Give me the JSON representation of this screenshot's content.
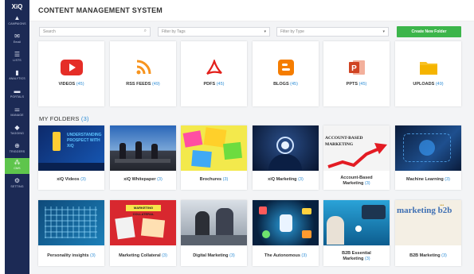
{
  "app": {
    "logo": "XiQ",
    "title": "CONTENT MANAGEMENT SYSTEM"
  },
  "sidebar": {
    "items": [
      {
        "label": "CAMPAIGNS",
        "icon": "megaphone-icon",
        "glyph": "▲"
      },
      {
        "label": "Email",
        "icon": "envelope-icon",
        "glyph": "✉"
      },
      {
        "label": "LISTS",
        "icon": "list-icon",
        "glyph": "☰"
      },
      {
        "label": "ANALYTICS",
        "icon": "bar-chart-icon",
        "glyph": "▮"
      },
      {
        "label": "PORTALS",
        "icon": "portal-icon",
        "glyph": "▬"
      },
      {
        "label": "MANAGE",
        "icon": "sliders-icon",
        "glyph": "⚌"
      },
      {
        "label": "TAGGING",
        "icon": "tag-icon",
        "glyph": "◆"
      },
      {
        "label": "TRIGGERS",
        "icon": "trigger-icon",
        "glyph": "⊕"
      },
      {
        "label": "CMS",
        "icon": "sitemap-icon",
        "glyph": "⁂",
        "active": true
      },
      {
        "label": "SETTING",
        "icon": "gear-icon",
        "glyph": "⚙"
      }
    ]
  },
  "filters": {
    "search_placeholder": "Search",
    "tags_placeholder": "Filter by Tags",
    "type_placeholder": "Filter by Type",
    "create_label": "Create New Folder"
  },
  "types": [
    {
      "name": "VIDEOS",
      "count": "(45)",
      "icon": "youtube-icon",
      "color": "#e52d27"
    },
    {
      "name": "RSS FEEDS",
      "count": "(49)",
      "icon": "rss-icon",
      "color": "#f7941e"
    },
    {
      "name": "PDFS",
      "count": "(45)",
      "icon": "pdf-icon",
      "color": "#e3201b"
    },
    {
      "name": "BLOGS",
      "count": "(45)",
      "icon": "blogger-icon",
      "color": "#f57d00"
    },
    {
      "name": "PPTS",
      "count": "(45)",
      "icon": "powerpoint-icon",
      "color": "#d04423"
    },
    {
      "name": "UPLOADS",
      "count": "(49)",
      "icon": "folder-icon",
      "color": "#f8c123"
    }
  ],
  "folders_section": {
    "title": "MY FOLDERS",
    "count": "(3)"
  },
  "folders": [
    {
      "name": "xiQ Videos",
      "count": "(3)",
      "thumb_text": "UNDERSTANDING PROSPECT WITH XiQ"
    },
    {
      "name": "xiQ Whitepaper",
      "count": "(3)",
      "thumb_text": ""
    },
    {
      "name": "Brochures",
      "count": "(3)",
      "thumb_text": ""
    },
    {
      "name": "xiQ Marketing",
      "count": "(3)",
      "thumb_text": ""
    },
    {
      "name": "Account-Based Marketing",
      "count": "(3)",
      "thumb_text": "ACCOUNT-BASED MARKETING"
    },
    {
      "name": "Machine Learning",
      "count": "(3)",
      "thumb_text": ""
    },
    {
      "name": "Personality insights",
      "count": "(3)",
      "thumb_text": ""
    },
    {
      "name": "Marketing Collateral",
      "count": "(3)",
      "thumb_text": "MARKETING COLLATERAL"
    },
    {
      "name": "Digital Marketing",
      "count": "(3)",
      "thumb_text": ""
    },
    {
      "name": "The Autonomous",
      "count": "(3)",
      "thumb_text": ""
    },
    {
      "name": "B2B Essential Marketing",
      "count": "(3)",
      "thumb_text": ""
    },
    {
      "name": "B2B Marketing",
      "count": "(3)",
      "thumb_text": "marketing b2b"
    }
  ],
  "colors": {
    "sidebar": "#1c2a55",
    "active": "#5ec54c",
    "accent_button": "#3cb54b",
    "count_blue": "#2f8ed6"
  }
}
